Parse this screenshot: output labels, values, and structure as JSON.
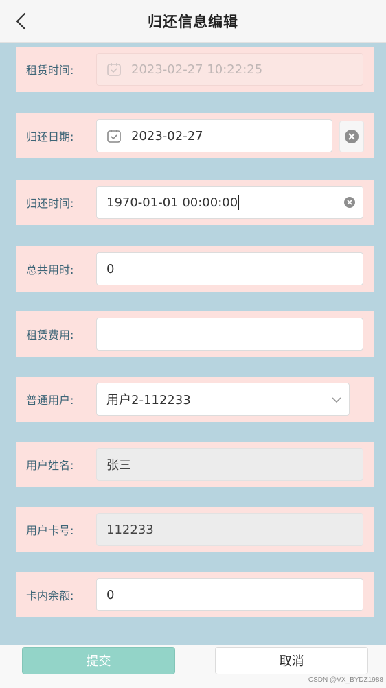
{
  "header": {
    "title": "归还信息编辑"
  },
  "fields": {
    "rent_time": {
      "label": "租赁时间:",
      "value": "2023-02-27 10:22:25"
    },
    "return_date": {
      "label": "归还日期:",
      "value": "2023-02-27"
    },
    "return_time": {
      "label": "归还时间:",
      "value": "1970-01-01 00:00:00"
    },
    "total_time": {
      "label": "总共用时:",
      "value": "0"
    },
    "rent_fee": {
      "label": "租赁费用:",
      "value": ""
    },
    "user": {
      "label": "普通用户:",
      "value": "用户2-112233"
    },
    "user_name": {
      "label": "用户姓名:",
      "value": "张三"
    },
    "card_no": {
      "label": "用户卡号:",
      "value": "112233"
    },
    "balance": {
      "label": "卡内余额:",
      "value": "0"
    }
  },
  "footer": {
    "submit_label": "提交",
    "cancel_label": "取消"
  },
  "watermark": "CSDN @VX_BYDZ1988",
  "colors": {
    "page_bg": "#b7d4df",
    "row_bg": "#fde1de",
    "label": "#3d6577",
    "submit_bg": "#93d4c8"
  }
}
